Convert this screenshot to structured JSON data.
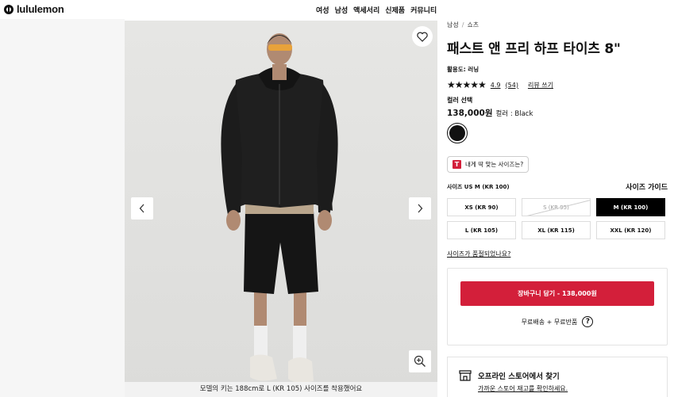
{
  "header": {
    "logo_text": "lululemon",
    "nav": [
      "여성",
      "남성",
      "액세서리",
      "신제품",
      "커뮤니티"
    ]
  },
  "gallery": {
    "caption": "모델의 키는 188cm로 L (KR 105) 사이즈를 착용했어요",
    "icons": {
      "wishlist": "heart-icon",
      "prev": "chevron-left-icon",
      "next": "chevron-right-icon",
      "zoom": "zoom-in-icon"
    }
  },
  "product": {
    "breadcrumb": [
      "남성",
      "쇼츠"
    ],
    "title": "패스트 앤 프리 하프 타이츠 8\"",
    "activity": "활용도: 러닝",
    "rating": {
      "stars": "★★★★★",
      "value": "4.9",
      "count": "(54)",
      "write_review": "리뷰 쓰기",
      "score": 4.9
    },
    "color_select_label": "컬러 선택",
    "price": "138,000원",
    "color_label": "컬러 : Black",
    "swatch_color": "#111111",
    "fit_button": "내게 딱 맞는 사이즈는?",
    "fit_icon_letter": "T",
    "size_label": "사이즈 US M (KR 100)",
    "size_guide": "사이즈 가이드",
    "sizes": [
      {
        "label": "XS (KR 90)",
        "state": "available"
      },
      {
        "label": "S (KR 95)",
        "state": "disabled"
      },
      {
        "label": "M (KR 100)",
        "state": "selected"
      },
      {
        "label": "L (KR 105)",
        "state": "available"
      },
      {
        "label": "XL (KR 115)",
        "state": "available"
      },
      {
        "label": "XXL (KR 120)",
        "state": "available"
      }
    ],
    "size_question": "사이즈가 품절되었나요?",
    "add_to_cart": "장바구니 담기 - 138,000원",
    "shipping": "무료배송 + 무료반품",
    "store": {
      "title": "오프라인 스토어에서 찾기",
      "subtitle": "가까운 스토어 재고를 확인하세요."
    }
  },
  "colors": {
    "accent": "#d31f3a",
    "selected": "#000000"
  }
}
